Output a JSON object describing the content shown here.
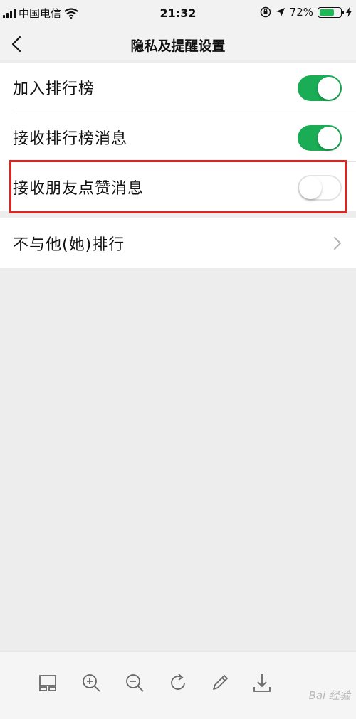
{
  "status_bar": {
    "carrier": "中国电信",
    "time": "21:32",
    "battery": "72%",
    "battery_level": 0.72,
    "signal_icon": "signal-icon",
    "wifi_icon": "wifi-icon"
  },
  "nav": {
    "title": "隐私及提醒设置",
    "back_icon": "chevron-left-icon"
  },
  "settings": [
    {
      "label": "加入排行榜",
      "enabled": true
    },
    {
      "label": "接收排行榜消息",
      "enabled": true
    },
    {
      "label": "接收朋友点赞消息",
      "enabled": false
    }
  ],
  "exclude_row": {
    "label": "不与他(她)排行",
    "icon": "chevron-right-icon"
  },
  "toolbar": {
    "icons": [
      "layout-icon",
      "zoom-in-icon",
      "zoom-out-icon",
      "rotate-icon",
      "edit-icon",
      "download-icon"
    ]
  },
  "watermark": "Bai 经验",
  "colors": {
    "accent": "#1aad55",
    "highlight": "#e0231e",
    "background": "#ededed"
  }
}
